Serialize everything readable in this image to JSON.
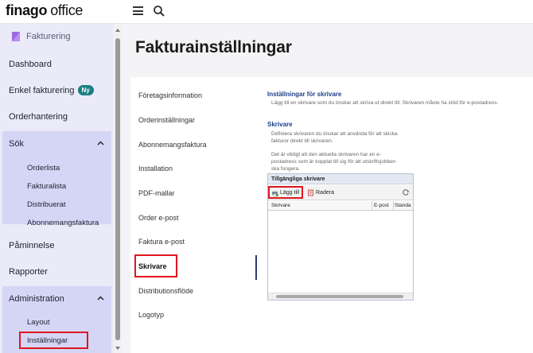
{
  "topbar": {
    "logo_brand": "finago",
    "logo_product": "office",
    "menu_icon": "hamburger-icon",
    "search_icon": "search-icon"
  },
  "sidebar": {
    "app_name": "Fakturering",
    "items": {
      "dashboard": "Dashboard",
      "enkel": "Enkel fakturering",
      "enkel_badge": "Ny",
      "orderhantering": "Orderhantering",
      "pamminnelse": "Påminnelse",
      "rapporter": "Rapporter"
    },
    "sok": {
      "label": "Sök",
      "children": [
        "Orderlista",
        "Fakturalista",
        "Distribuerat",
        "Abonnemangsfaktura"
      ]
    },
    "administration": {
      "label": "Administration",
      "children": [
        "Layout",
        "Inställningar"
      ]
    }
  },
  "main": {
    "title": "Fakturainställningar",
    "subnav": [
      "Företagsinformation",
      "Orderinställningar",
      "Abonnemangsfaktura",
      "Installation",
      "PDF-mallar",
      "Order e-post",
      "Faktura e-post",
      "Skrivare",
      "Distributionsflöde",
      "Logotyp"
    ],
    "active_subnav": "Skrivare",
    "content": {
      "heading": "Inställningar för skrivare",
      "intro": "Lägg till en skrivare som du önskar att skriva ut direkt till. Skrivaren måste ha stöd för e-postadress.",
      "section_title": "Skrivare",
      "section_desc1_line1": "Definiera skrivaren du önskar att använda för att skicka",
      "section_desc1_line2": "fakturor direkt till skrivaren.",
      "section_desc2_line1": "Det är viktigt att den aktuella skrivaren har en e-",
      "section_desc2_line2": "postadress som är kopplat till sig för att utskriftsjobben",
      "section_desc2_line3": "ska fungera.",
      "grid": {
        "title": "Tillgängliga skrivare",
        "add_label": "Lägg till",
        "delete_label": "Radera",
        "columns": [
          "Skrivare",
          "E-post",
          "Standa"
        ]
      }
    }
  },
  "colors": {
    "sidebar_bg": "#eaeaf8",
    "section_bg": "#d5d6f6",
    "highlight_red": "#e0161f",
    "badge_teal": "#1c7f84",
    "heading_blue": "#1c3f8a"
  }
}
